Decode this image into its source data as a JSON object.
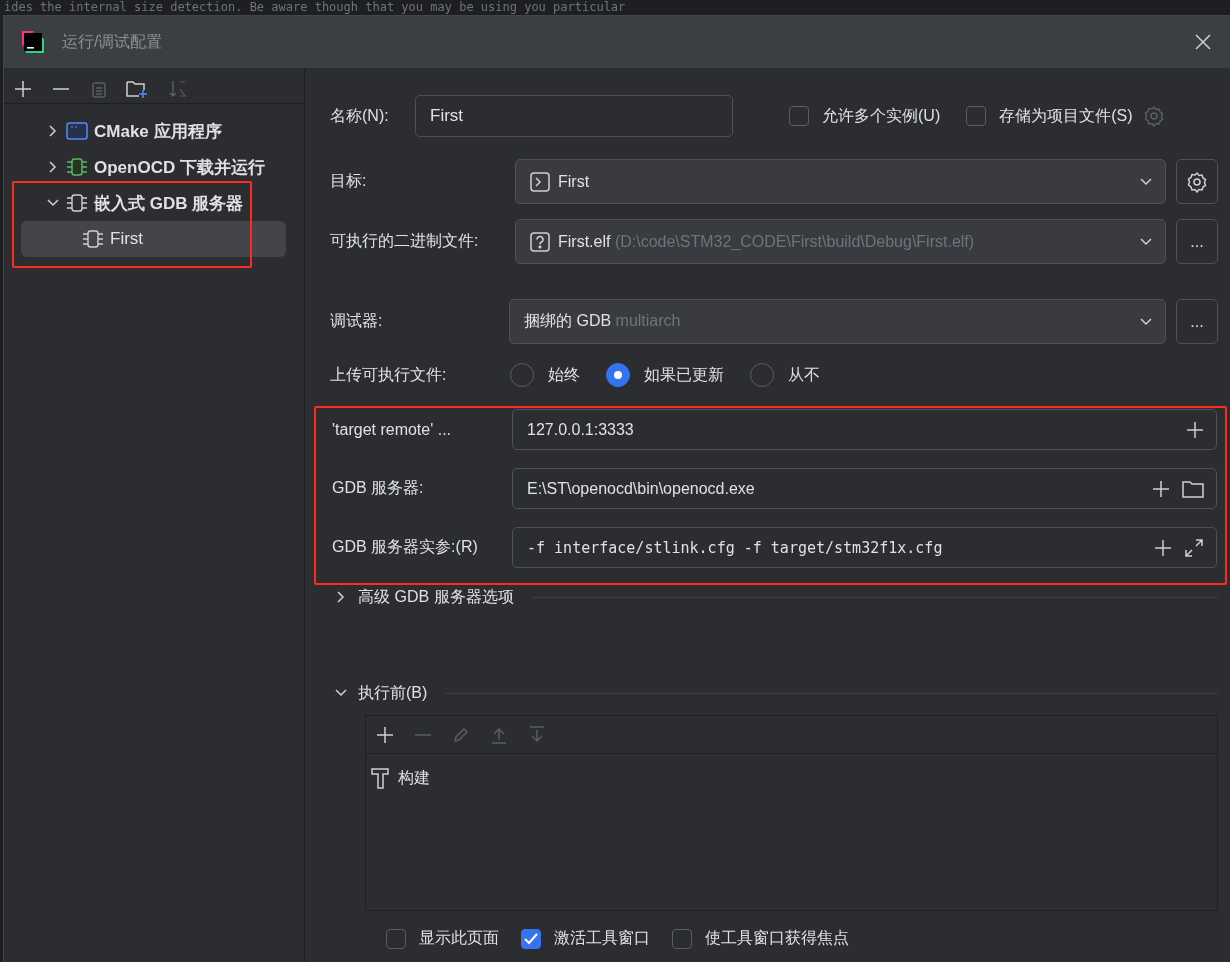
{
  "background_text": "ides the internal size detection. Be aware though that you may be using you particular",
  "window": {
    "title": "运行/调试配置"
  },
  "toolbar": [
    {
      "kind": "add",
      "disabled": false
    },
    {
      "kind": "remove",
      "disabled": false
    },
    {
      "kind": "copy",
      "disabled": true
    },
    {
      "kind": "new-folder",
      "disabled": false
    },
    {
      "kind": "sort",
      "disabled": true
    }
  ],
  "tree": [
    {
      "label": "CMake 应用程序",
      "kind": "app",
      "expanded": false,
      "selected": false,
      "highlighted": false
    },
    {
      "label": "OpenOCD 下载并运行",
      "kind": "chip-green",
      "expanded": false,
      "selected": false,
      "highlighted": false
    },
    {
      "label": "嵌入式 GDB 服务器",
      "kind": "chip",
      "expanded": true,
      "selected": false,
      "highlighted": true,
      "children": [
        {
          "label": "First",
          "kind": "chip",
          "selected": true
        }
      ]
    }
  ],
  "form": {
    "name": {
      "label": "名称(N):",
      "value": "First"
    },
    "flags": [
      {
        "label": "允许多个实例(U)",
        "checked": false
      },
      {
        "label": "存储为项目文件(S)",
        "checked": false
      }
    ],
    "target": {
      "label": "目标:",
      "value": "First"
    },
    "executable": {
      "label": "可执行的二进制文件:",
      "value": "First.elf",
      "hint": "(D:\\code\\STM32_CODE\\First\\build\\Debug\\First.elf)",
      "button": "..."
    },
    "debugger": {
      "label": "调试器:",
      "value": "捆绑的 GDB",
      "hint": "multiarch",
      "button": "..."
    },
    "upload": {
      "label": "上传可执行文件:",
      "options": [
        {
          "label": "始终",
          "selected": false
        },
        {
          "label": "如果已更新",
          "selected": true
        },
        {
          "label": "从不",
          "selected": false
        }
      ]
    },
    "remote": {
      "highlighted": true,
      "fields": [
        {
          "label": "'target remote' ...",
          "value": "127.0.0.1:3333",
          "kind": "text",
          "actions": [
            {
              "kind": "add"
            }
          ]
        },
        {
          "label": "GDB 服务器:",
          "value": "E:\\ST\\openocd\\bin\\openocd.exe",
          "kind": "text",
          "actions": [
            {
              "kind": "add"
            },
            {
              "kind": "folder"
            }
          ]
        },
        {
          "label": "GDB 服务器实参:(R)",
          "value": "-f interface/stlink.cfg -f target/stm32f1x.cfg",
          "kind": "code",
          "actions": [
            {
              "kind": "add"
            },
            {
              "kind": "expand"
            }
          ]
        }
      ]
    },
    "advanced": {
      "label": "高级 GDB 服务器选项",
      "expanded": false
    },
    "before_launch": {
      "label": "执行前(B)",
      "expanded": true,
      "toolbar": [
        {
          "kind": "add",
          "disabled": false
        },
        {
          "kind": "remove",
          "disabled": true
        },
        {
          "kind": "edit",
          "disabled": true
        },
        {
          "kind": "up",
          "disabled": true
        },
        {
          "kind": "down",
          "disabled": true
        }
      ],
      "tasks": [
        {
          "label": "构建",
          "kind": "build"
        }
      ]
    },
    "options": [
      {
        "label": "显示此页面",
        "checked": false
      },
      {
        "label": "激活工具窗口",
        "checked": true
      },
      {
        "label": "使工具窗口获得焦点",
        "checked": false
      }
    ]
  }
}
